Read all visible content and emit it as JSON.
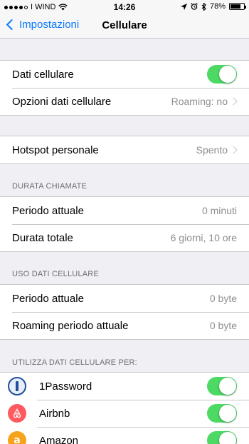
{
  "status_bar": {
    "carrier": "I WIND",
    "time": "14:26",
    "battery": "78%",
    "battery_level": 0.78,
    "icons": [
      "signal-dots-icon",
      "wifi-icon",
      "location-icon",
      "alarm-icon",
      "bluetooth-icon",
      "battery-icon"
    ]
  },
  "nav": {
    "back_label": "Impostazioni",
    "title": "Cellulare"
  },
  "group1": {
    "dati_cellulare": {
      "label": "Dati cellulare",
      "toggle": true
    },
    "opzioni": {
      "label": "Opzioni dati cellulare",
      "value": "Roaming: no"
    }
  },
  "group2": {
    "hotspot": {
      "label": "Hotspot personale",
      "value": "Spento"
    }
  },
  "durata_chiamate": {
    "header": "DURATA CHIAMATE",
    "rows": [
      {
        "label": "Periodo attuale",
        "value": "0 minuti"
      },
      {
        "label": "Durata totale",
        "value": "6 giorni, 10 ore"
      }
    ]
  },
  "uso_dati": {
    "header": "USO DATI CELLULARE",
    "rows": [
      {
        "label": "Periodo attuale",
        "value": "0 byte"
      },
      {
        "label": "Roaming periodo attuale",
        "value": "0 byte"
      }
    ]
  },
  "apps": {
    "header": "UTILIZZA DATI CELLULARE PER:",
    "items": [
      {
        "label": "1Password",
        "toggle": true,
        "icon": "1password-icon"
      },
      {
        "label": "Airbnb",
        "toggle": true,
        "icon": "airbnb-icon"
      },
      {
        "label": "Amazon",
        "toggle": true,
        "icon": "amazon-icon"
      }
    ]
  },
  "colors": {
    "accent": "#0a7aff",
    "toggle_on": "#4cd964",
    "background": "#efeff4",
    "secondary_text": "#8e8e93"
  }
}
